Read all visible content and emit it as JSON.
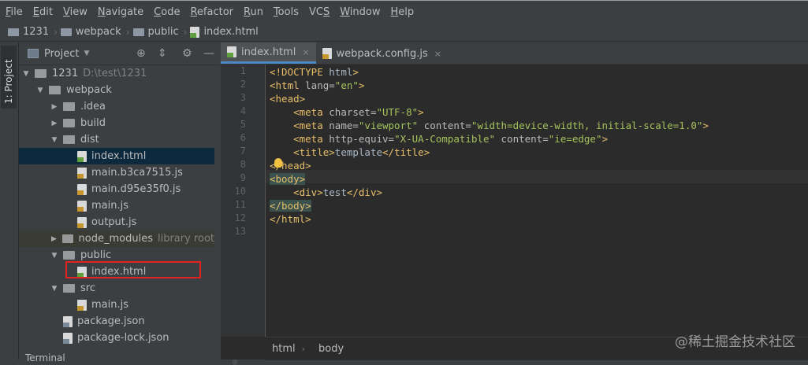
{
  "menu": [
    "File",
    "Edit",
    "View",
    "Navigate",
    "Code",
    "Refactor",
    "Run",
    "Tools",
    "VCS",
    "Window",
    "Help"
  ],
  "menu_mnemonics": [
    "F",
    "E",
    "V",
    "N",
    "C",
    "R",
    "R",
    "T",
    "S",
    "W",
    "H"
  ],
  "breadcrumb": [
    {
      "label": "1231",
      "icon": "folder-icon"
    },
    {
      "label": "webpack",
      "icon": "folder-icon"
    },
    {
      "label": "public",
      "icon": "folder-icon"
    },
    {
      "label": "index.html",
      "icon": "html-file-icon"
    }
  ],
  "tool_strip": {
    "project_tab": "1: Project"
  },
  "panel": {
    "title": "Project"
  },
  "tree": [
    {
      "label": "1231",
      "hint": "D:\\test\\1231",
      "indent": 0,
      "type": "folder",
      "open": true
    },
    {
      "label": "webpack",
      "indent": 1,
      "type": "folder",
      "open": true
    },
    {
      "label": ".idea",
      "indent": 2,
      "type": "folder",
      "open": false
    },
    {
      "label": "build",
      "indent": 2,
      "type": "folder",
      "open": false
    },
    {
      "label": "dist",
      "indent": 2,
      "type": "folder",
      "open": true
    },
    {
      "label": "index.html",
      "indent": 3,
      "type": "html",
      "selected": true
    },
    {
      "label": "main.b3ca7515.js",
      "indent": 3,
      "type": "js"
    },
    {
      "label": "main.d95e35f0.js",
      "indent": 3,
      "type": "js"
    },
    {
      "label": "main.js",
      "indent": 3,
      "type": "bin"
    },
    {
      "label": "output.js",
      "indent": 3,
      "type": "js"
    },
    {
      "label": "node_modules",
      "hint": "library root",
      "indent": 2,
      "type": "folder",
      "open": false,
      "library": true
    },
    {
      "label": "public",
      "indent": 2,
      "type": "folder",
      "open": true
    },
    {
      "label": "index.html",
      "indent": 3,
      "type": "html",
      "highlight": true
    },
    {
      "label": "src",
      "indent": 2,
      "type": "folder",
      "open": true
    },
    {
      "label": "main.js",
      "indent": 3,
      "type": "js"
    },
    {
      "label": "package.json",
      "indent": 2,
      "type": "json"
    },
    {
      "label": "package-lock.json",
      "indent": 2,
      "type": "json"
    }
  ],
  "tabs": [
    {
      "label": "index.html",
      "active": true,
      "icon": "html-file-icon"
    },
    {
      "label": "webpack.config.js",
      "active": false,
      "icon": "js-file-icon"
    }
  ],
  "line_numbers": [
    "1",
    "2",
    "3",
    "4",
    "5",
    "6",
    "7",
    "8",
    "9",
    "10",
    "11",
    "12",
    "13"
  ],
  "code": [
    {
      "indent": "",
      "parts": [
        [
          "tg",
          "<!DOCTYPE "
        ],
        [
          "tx",
          "html"
        ],
        [
          "tg",
          ">"
        ]
      ]
    },
    {
      "indent": "",
      "parts": [
        [
          "tg",
          "<html "
        ],
        [
          "at",
          "lang="
        ],
        [
          "sv",
          "\"en\""
        ],
        [
          "tg",
          ">"
        ]
      ]
    },
    {
      "indent": "",
      "parts": [
        [
          "tg",
          "<head>"
        ]
      ]
    },
    {
      "indent": "    ",
      "parts": [
        [
          "tg",
          "<meta "
        ],
        [
          "at",
          "charset="
        ],
        [
          "sv",
          "\"UTF-8\""
        ],
        [
          "tg",
          ">"
        ]
      ]
    },
    {
      "indent": "    ",
      "parts": [
        [
          "tg",
          "<meta "
        ],
        [
          "at",
          "name="
        ],
        [
          "sv",
          "\"viewport\""
        ],
        [
          "at",
          " content="
        ],
        [
          "sv",
          "\"width=device-width, initial-scale=1.0\""
        ],
        [
          "tg",
          ">"
        ]
      ]
    },
    {
      "indent": "    ",
      "parts": [
        [
          "tg",
          "<meta "
        ],
        [
          "at",
          "http-equiv="
        ],
        [
          "sv",
          "\"X-UA-Compatible\""
        ],
        [
          "at",
          " content="
        ],
        [
          "sv",
          "\"ie=edge\""
        ],
        [
          "tg",
          ">"
        ]
      ]
    },
    {
      "indent": "    ",
      "parts": [
        [
          "tg",
          "<title>"
        ],
        [
          "tx",
          "template"
        ],
        [
          "tg",
          "</title>"
        ]
      ]
    },
    {
      "indent": "",
      "parts": [
        [
          "tg",
          "</head>"
        ]
      ]
    },
    {
      "indent": "",
      "parts": [
        [
          "tg",
          "<body>"
        ]
      ]
    },
    {
      "indent": "    ",
      "parts": [
        [
          "tg",
          "<div>"
        ],
        [
          "tx",
          "test"
        ],
        [
          "tg",
          "</div>"
        ]
      ]
    },
    {
      "indent": "",
      "parts": [
        [
          "tg",
          "</body>"
        ]
      ]
    },
    {
      "indent": "",
      "parts": [
        [
          "tg",
          "</html>"
        ]
      ]
    },
    {
      "indent": "",
      "parts": []
    }
  ],
  "status_path": [
    "html",
    "body"
  ],
  "watermark": "@稀土掘金技术社区",
  "terminal_label": "Terminal"
}
